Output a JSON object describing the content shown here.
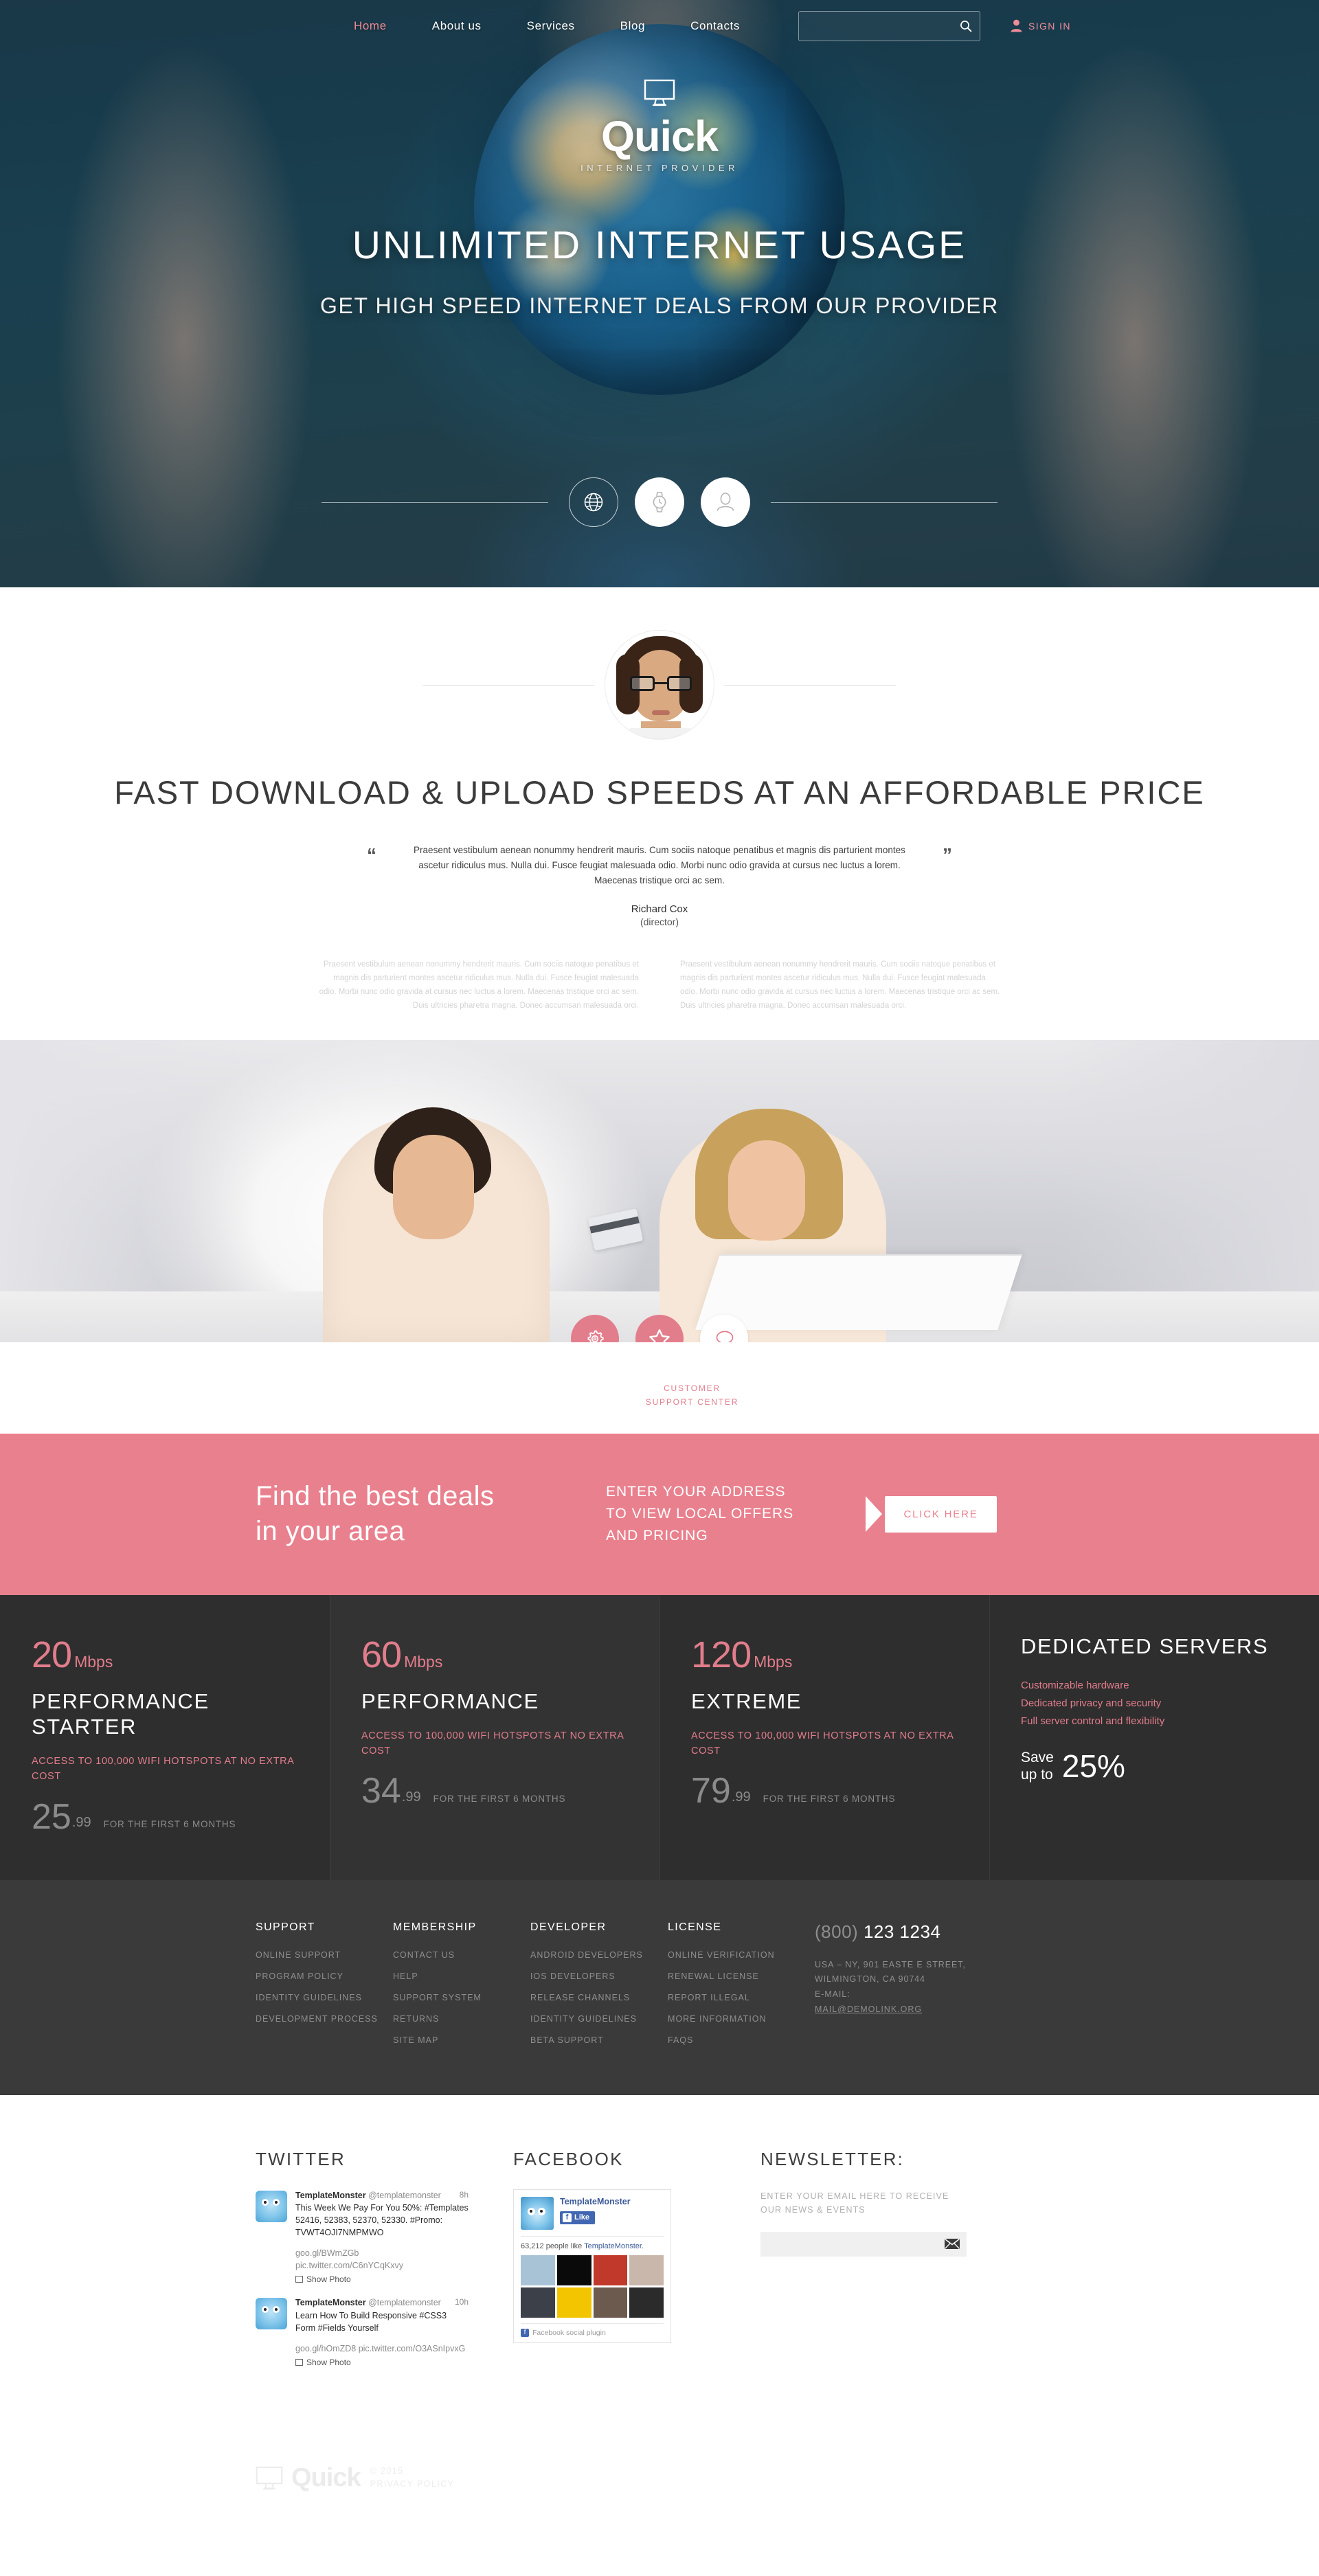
{
  "nav": {
    "items": [
      {
        "label": "Home",
        "active": true
      },
      {
        "label": "About us",
        "active": false
      },
      {
        "label": "Services",
        "active": false
      },
      {
        "label": "Blog",
        "active": false
      },
      {
        "label": "Contacts",
        "active": false
      }
    ],
    "search_placeholder": "",
    "search_value": "",
    "signin_label": "SIGN IN"
  },
  "logo": {
    "name": "Quick",
    "tagline": "INTERNET PROVIDER"
  },
  "hero": {
    "headline": "UNLIMITED INTERNET USAGE",
    "subline": "GET HIGH SPEED INTERNET DEALS FROM OUR PROVIDER",
    "icons": [
      {
        "name": "globe-icon",
        "style": "outline"
      },
      {
        "name": "watch-icon",
        "style": "solid"
      },
      {
        "name": "user-icon",
        "style": "solid"
      }
    ]
  },
  "testimonial": {
    "heading": "FAST DOWNLOAD & UPLOAD SPEEDS AT AN AFFORDABLE PRICE",
    "quote_open": "“",
    "quote_close": "”",
    "quote": "Praesent vestibulum aenean nonummy hendrerit mauris. Cum sociis natoque penatibus et magnis dis parturient montes ascetur ridiculus mus. Nulla dui. Fusce feugiat malesuada odio. Morbi nunc odio gravida at cursus nec luctus a lorem. Maecenas tristique orci ac sem.",
    "author": "Richard Cox",
    "role": "(director)",
    "col_left": "Praesent vestibulum aenean nonummy hendrerit mauris. Cum sociis natoque penatibus et magnis dis parturient montes ascetur ridiculus mus. Nulla dui. Fusce feugiat malesuada odio. Morbi nunc odio gravida at cursus nec luctus a lorem. Maecenas tristique orci ac sem. Duis ultricies pharetra magna. Donec accumsan malesuada orci.",
    "col_right": "Praesent vestibulum aenean nonummy hendrerit mauris. Cum sociis natoque penatibus et magnis dis parturient montes ascetur ridiculus mus. Nulla dui. Fusce feugiat malesuada odio. Morbi nunc odio gravida at cursus nec luctus a lorem. Maecenas tristique orci ac sem. Duis ultricies pharetra magna. Donec accumsan malesuada orci."
  },
  "support": {
    "icons": [
      {
        "name": "gear-icon",
        "style": "pink"
      },
      {
        "name": "star-icon",
        "style": "pink"
      },
      {
        "name": "chat-bubble-icon",
        "style": "white"
      }
    ],
    "label_line1": "CUSTOMER",
    "label_line2": "SUPPORT CENTER"
  },
  "cta": {
    "heading_line1": "Find the best deals",
    "heading_line2": "in your area",
    "sub_line1": "ENTER YOUR ADDRESS",
    "sub_line2": "TO VIEW LOCAL OFFERS",
    "sub_line3": "AND PRICING",
    "button_label": "CLICK HERE",
    "background": "#e9808e"
  },
  "pricing": {
    "plans": [
      {
        "speed": "20",
        "unit": "Mbps",
        "title": "PERFORMANCE STARTER",
        "feature": "ACCESS TO 100,000 WIFI HOTSPOTS AT NO EXTRA COST",
        "price": "25",
        "cents": ".99",
        "note": "FOR THE FIRST 6 MONTHS"
      },
      {
        "speed": "60",
        "unit": "Mbps",
        "title": "PERFORMANCE",
        "feature": "ACCESS TO 100,000 WIFI HOTSPOTS AT NO EXTRA COST",
        "price": "34",
        "cents": ".99",
        "note": "FOR THE FIRST 6 MONTHS"
      },
      {
        "speed": "120",
        "unit": "Mbps",
        "title": "EXTREME",
        "feature": "ACCESS TO 100,000 WIFI HOTSPOTS AT NO EXTRA COST",
        "price": "79",
        "cents": ".99",
        "note": "FOR THE FIRST 6 MONTHS"
      }
    ],
    "dedicated": {
      "title": "DEDICATED SERVERS",
      "features": [
        "Customizable hardware",
        "Dedicated privacy and security",
        "Full server control and flexibility"
      ],
      "save_label_line1": "Save",
      "save_label_line2": "up to",
      "save_value": "25%"
    },
    "accent": "#e27d8c"
  },
  "footer_links": {
    "columns": [
      {
        "head": "SUPPORT",
        "items": [
          "ONLINE SUPPORT",
          "PROGRAM POLICY",
          "IDENTITY GUIDELINES",
          "DEVELOPMENT PROCESS"
        ]
      },
      {
        "head": "MEMBERSHIP",
        "items": [
          "CONTACT US",
          "HELP",
          "SUPPORT SYSTEM",
          "RETURNS",
          "SITE MAP"
        ]
      },
      {
        "head": "DEVELOPER",
        "items": [
          "ANDROID DEVELOPERS",
          "IOS DEVELOPERS",
          "RELEASE CHANNELS",
          "IDENTITY GUIDELINES",
          "BETA SUPPORT"
        ]
      },
      {
        "head": "LICENSE",
        "items": [
          "ONLINE VERIFICATION",
          "RENEWAL LICENSE",
          "REPORT ILLEGAL",
          "MORE INFORMATION",
          "FAQS"
        ]
      }
    ],
    "contact": {
      "phone_code": "(800)",
      "phone_number": "123 1234",
      "address_line1": "USA – NY, 901 EASTE E STREET,",
      "address_line2": "WILMINGTON, CA 90744",
      "email_label": "E-MAIL:",
      "email": "MAIL@DEMOLINK.ORG"
    }
  },
  "social": {
    "twitter": {
      "head": "TWITTER",
      "tweets": [
        {
          "name": "TemplateMonster",
          "handle": "@templatemonster",
          "time": "8h",
          "text": "This Week We Pay For You 50%: #Templates 52416, 52383, 52370, 52330. #Promo: TVWT4OJI7NMPMWO",
          "links": "goo.gl/BWmZGb pic.twitter.com/C6nYCqKxvy",
          "show_photo": "Show Photo"
        },
        {
          "name": "TemplateMonster",
          "handle": "@templatemonster",
          "time": "10h",
          "text": "Learn How To Build Responsive #CSS3 Form #Fields Yourself",
          "links": "goo.gl/hOmZD8 pic.twitter.com/O3ASnIpvxG",
          "show_photo": "Show Photo"
        }
      ]
    },
    "facebook": {
      "head": "FACEBOOK",
      "page_name": "TemplateMonster",
      "like_label": "Like",
      "like_icon": "f",
      "count_prefix": "63,212 people like ",
      "count_name": "TemplateMonster",
      "count_suffix": ".",
      "plugin_label": "Facebook social plugin",
      "thumb_colors": [
        "#a9c3d6",
        "#0a0a0a",
        "#c0392b",
        "#c9b7ab",
        "#3b4049",
        "#f2c500",
        "#6d5a4f",
        "#2b2b2b"
      ]
    },
    "newsletter": {
      "head": "NEWSLETTER:",
      "text_line1": "ENTER YOUR EMAIL HERE TO RECEIVE",
      "text_line2": "OUR NEWS & EVENTS",
      "input_placeholder": "",
      "input_value": "",
      "submit_icon": "envelope-icon"
    }
  },
  "bottom": {
    "logo_name": "Quick",
    "copyright": "© 2015",
    "privacy": "PRIVACY POLICY"
  }
}
